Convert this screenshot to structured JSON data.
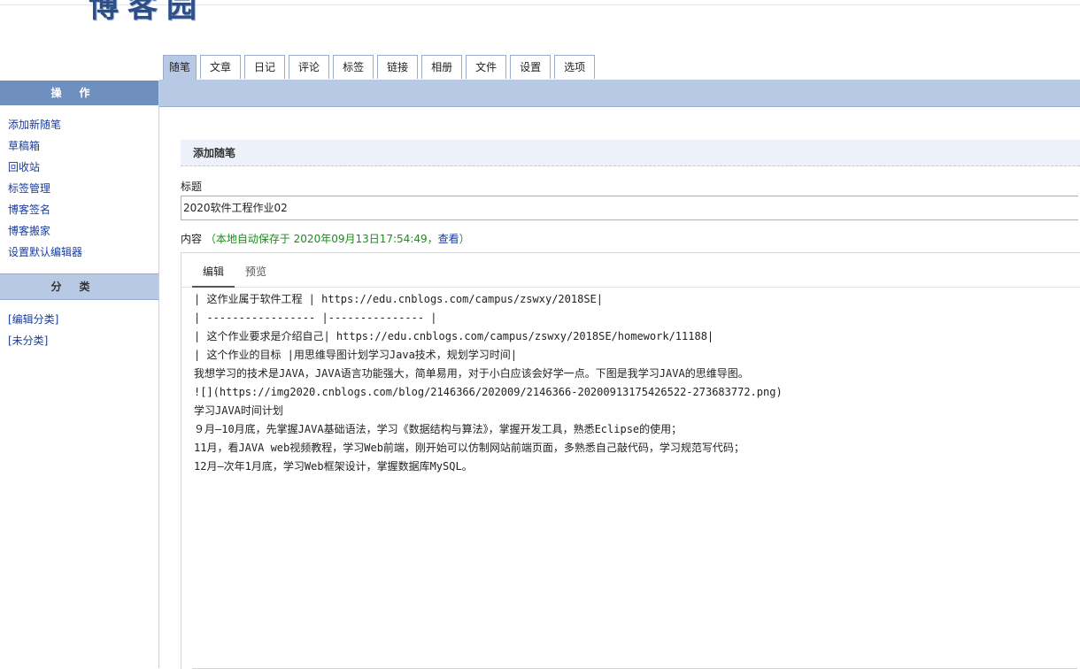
{
  "logo": {
    "text": "博客园"
  },
  "tabs": [
    "随笔",
    "文章",
    "日记",
    "评论",
    "标签",
    "链接",
    "相册",
    "文件",
    "设置",
    "选项"
  ],
  "sidebar": {
    "ops_header": "操作",
    "ops_items": [
      "添加新随笔",
      "草稿箱",
      "回收站",
      "标签管理",
      "博客签名",
      "博客搬家",
      "设置默认编辑器"
    ],
    "cat_header": "分类",
    "cat_items": [
      "[编辑分类]",
      "[未分类]"
    ]
  },
  "main": {
    "section_title": "添加随笔",
    "title_label": "标题",
    "title_value": "2020软件工程作业02",
    "content_label": "内容",
    "autosave_text": "（本地自动保存于 2020年09月13日17:54:49，",
    "view_link": "查看",
    "autosave_close": "）"
  },
  "editor": {
    "tabs": [
      "编辑",
      "预览"
    ],
    "lines": [
      "| 这作业属于软件工程 | https://edu.cnblogs.com/campus/zswxy/2018SE|",
      "| ----------------- |--------------- |",
      "| 这个作业要求是介绍自己| https://edu.cnblogs.com/campus/zswxy/2018SE/homework/11188|",
      "| 这个作业的目标 |用思维导图计划学习Java技术，规划学习时间|",
      "我想学习的技术是JAVA，JAVA语言功能强大，简单易用，对于小白应该会好学一点。下图是我学习JAVA的思维导图。",
      "![](https://img2020.cnblogs.com/blog/2146366/202009/2146366-20200913175426522-273683772.png)",
      "学习JAVA时间计划",
      "９月—10月底，先掌握JAVA基础语法，学习《数据结构与算法》，掌握开发工具，熟悉Eclipse的使用；",
      "11月，看JAVA web视频教程，学习Web前端，刚开始可以仿制网站前端页面，多熟悉自己敲代码，学习规范写代码；",
      "12月—次年1月底，学习Web框架设计，掌握数据库MySQL。"
    ]
  },
  "colors": {
    "accent_dark": "#6f8fbe",
    "accent_light": "#b8c9e6",
    "link": "#1a3c9c",
    "autosave": "#1f8a1f"
  }
}
